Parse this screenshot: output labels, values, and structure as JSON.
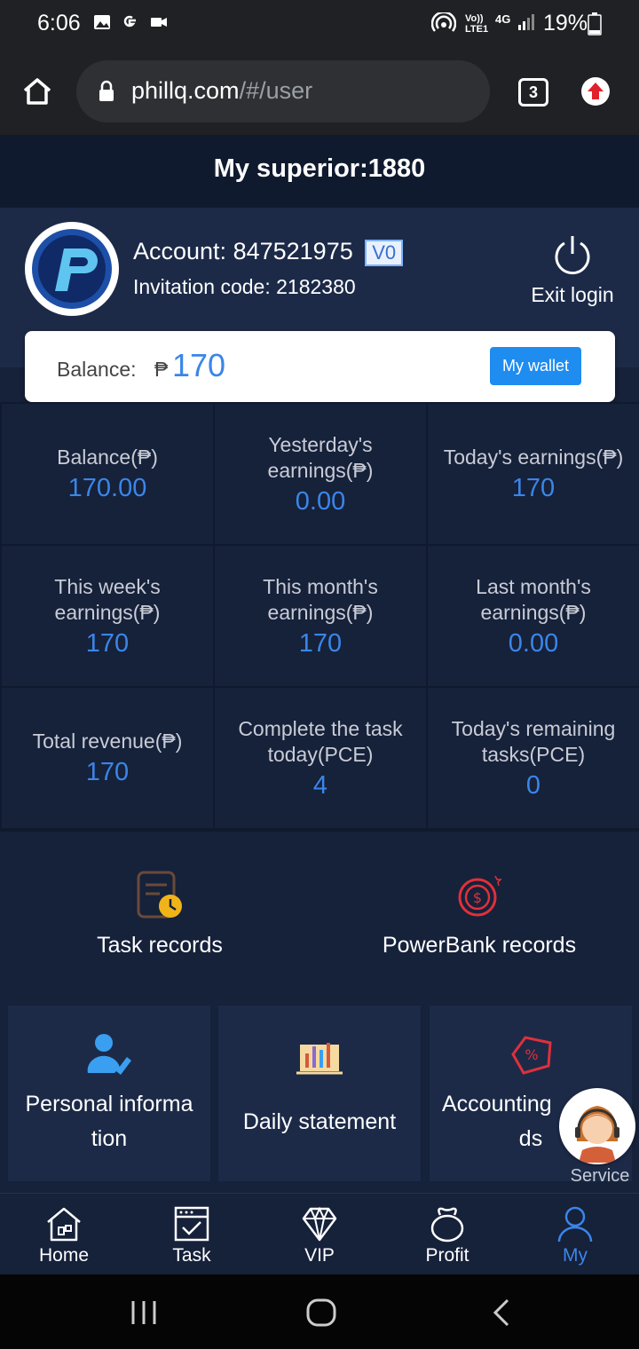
{
  "status_bar": {
    "time": "6:06",
    "battery": "19%",
    "icons": [
      "image-icon",
      "google-icon",
      "video-icon",
      "hotspot-icon",
      "volte-icon",
      "4g-icon",
      "signal-icon",
      "battery-icon"
    ],
    "volte_text": "Vo)) LTE1",
    "network_text": "4G"
  },
  "browser": {
    "url_host": "phillq.com",
    "url_path": "/#/user",
    "tab_count": "3"
  },
  "header": {
    "title": "My superior:1880"
  },
  "profile": {
    "account_label": "Account:",
    "account_value": "847521975",
    "vip_badge": "V0",
    "invite_label": "Invitation code:",
    "invite_value": "2182380",
    "exit_label": "Exit login"
  },
  "balance_card": {
    "label": "Balance:",
    "currency": "₱",
    "value": "170",
    "wallet_button": "My wallet"
  },
  "stats": [
    {
      "label": "Balance(₱)",
      "value": "170.00"
    },
    {
      "label": "Yesterday's earnings(₱)",
      "value": "0.00"
    },
    {
      "label": "Today's earnings(₱)",
      "value": "170"
    },
    {
      "label": "This week's earnings(₱)",
      "value": "170"
    },
    {
      "label": "This month's earnings(₱)",
      "value": "170"
    },
    {
      "label": "Last month's earnings(₱)",
      "value": "0.00"
    },
    {
      "label": "Total revenue(₱)",
      "value": "170"
    },
    {
      "label": "Complete the task today(PCE)",
      "value": "4"
    },
    {
      "label": "Today's remaining tasks(PCE)",
      "value": "0"
    }
  ],
  "records": {
    "task": "Task records",
    "powerbank": "PowerBank records"
  },
  "tiles": {
    "personal_line1": "Personal informa",
    "personal_line2": "tion",
    "daily": "Daily statement",
    "accounting_line1": "Accounting",
    "accounting_line2": "ds"
  },
  "service": {
    "label": "Service"
  },
  "nav": [
    {
      "label": "Home"
    },
    {
      "label": "Task"
    },
    {
      "label": "VIP"
    },
    {
      "label": "Profit"
    },
    {
      "label": "My"
    }
  ],
  "colors": {
    "accent": "#3a86e8",
    "background": "#16213a",
    "card": "#1c2a48"
  }
}
